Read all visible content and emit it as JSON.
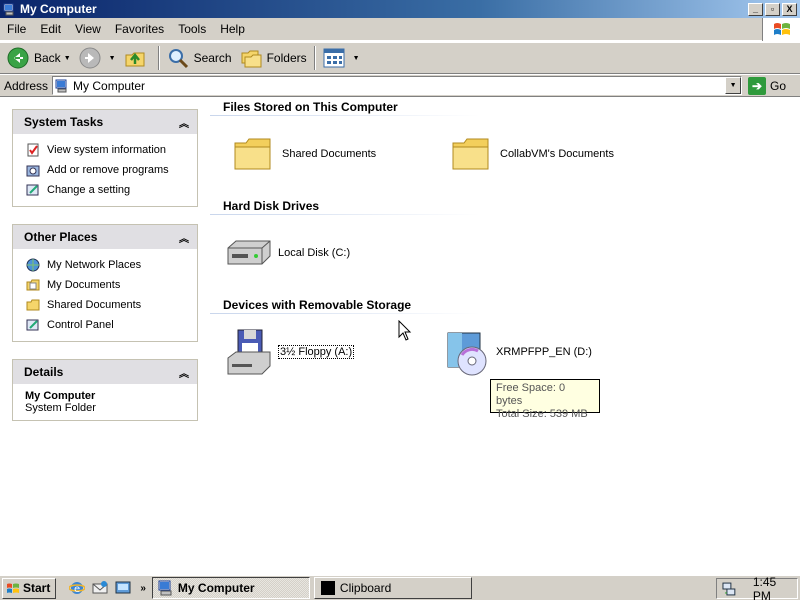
{
  "window": {
    "title": "My Computer"
  },
  "caption_buttons": {
    "minimize": "_",
    "maximize": "▫",
    "close": "X"
  },
  "menu": [
    "File",
    "Edit",
    "View",
    "Favorites",
    "Tools",
    "Help"
  ],
  "toolbar": {
    "back": "Back",
    "search": "Search",
    "folders": "Folders"
  },
  "address": {
    "label": "Address",
    "value": "My Computer",
    "go": "Go"
  },
  "system_tasks": {
    "title": "System Tasks",
    "items": [
      "View system information",
      "Add or remove programs",
      "Change a setting"
    ]
  },
  "other_places": {
    "title": "Other Places",
    "items": [
      "My Network Places",
      "My Documents",
      "Shared Documents",
      "Control Panel"
    ]
  },
  "details": {
    "title": "Details",
    "name": "My Computer",
    "type": "System Folder"
  },
  "groups": {
    "files": {
      "title": "Files Stored on This Computer",
      "items": [
        "Shared Documents",
        "CollabVM's Documents"
      ]
    },
    "disks": {
      "title": "Hard Disk Drives",
      "items": [
        "Local Disk (C:)"
      ]
    },
    "removable": {
      "title": "Devices with Removable Storage",
      "items": [
        "3½ Floppy (A:)",
        "XRMPFPP_EN (D:)"
      ]
    }
  },
  "tooltip": {
    "free": "Free Space: 0 bytes",
    "total": "Total Size: 539 MB"
  },
  "taskbar": {
    "start": "Start",
    "chevron": "»",
    "tasks": [
      "My Computer",
      "Clipboard"
    ],
    "clock": "1:45 PM"
  }
}
